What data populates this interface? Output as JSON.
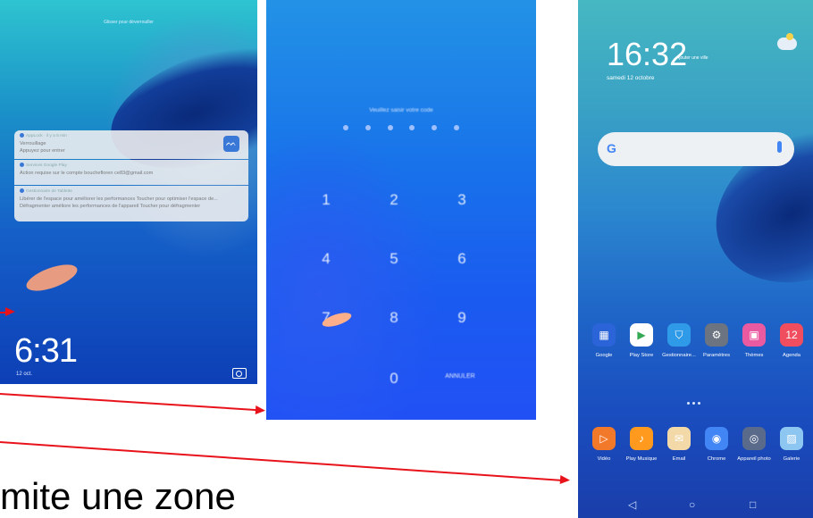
{
  "lock_screen": {
    "unlock_hint": "Glisser pour déverrouiller",
    "notifications": [
      {
        "app": "AppLock",
        "meta": "· il y a 5 min",
        "title": "Verrouillage",
        "text": "Appuyez pour entrer"
      },
      {
        "app": "Services Google Play",
        "meta": "",
        "title": "",
        "text": "Action requise sur le compte bouchefloren ce83@gmail.com"
      },
      {
        "app": "Gestionnaire de Tablette",
        "meta": "",
        "title": "",
        "text": "Libérer de l'espace pour améliorer les performances Toucher pour optimiser l'espace de... Défragmenter améliore les performances de l'appareil Toucher pour défragmenter"
      }
    ],
    "time": "6:31",
    "date": "12 oct."
  },
  "pin_screen": {
    "title": "Veuillez saisir votre code",
    "keys": [
      "1",
      "2",
      "3",
      "4",
      "5",
      "6",
      "7",
      "8",
      "9",
      "0"
    ],
    "cancel": "ANNULER"
  },
  "home_screen": {
    "time": "16:32",
    "add_city": "Ajouter une ville",
    "date": "samedi 12 octobre",
    "search_logo": "G",
    "apps_row1": [
      {
        "label": "Google",
        "icon": "folder-icon",
        "color": "#2b63d9",
        "glyph": "▦"
      },
      {
        "label": "Play Store",
        "icon": "play-store-icon",
        "color": "#ffffff",
        "glyph": "▶"
      },
      {
        "label": "Gestionnaire...",
        "icon": "shield-icon",
        "color": "#2f9ae8",
        "glyph": "⛉"
      },
      {
        "label": "Paramètres",
        "icon": "gear-icon",
        "color": "#6b7480",
        "glyph": "⚙"
      },
      {
        "label": "Thèmes",
        "icon": "brush-icon",
        "color": "#ea5aa0",
        "glyph": "▣"
      },
      {
        "label": "Agenda",
        "icon": "calendar-icon",
        "color": "#f04d5e",
        "glyph": "12"
      }
    ],
    "apps_row2": [
      {
        "label": "Vidéo",
        "icon": "video-icon",
        "color": "#f2792a",
        "glyph": "▷"
      },
      {
        "label": "Play Musique",
        "icon": "music-icon",
        "color": "#ff9a1f",
        "glyph": "♪"
      },
      {
        "label": "Email",
        "icon": "email-icon",
        "color": "#f3d9a8",
        "glyph": "✉"
      },
      {
        "label": "Chrome",
        "icon": "chrome-icon",
        "color": "#4285f4",
        "glyph": "◉"
      },
      {
        "label": "Appareil photo",
        "icon": "camera-icon",
        "color": "#5a6a8a",
        "glyph": "◎"
      },
      {
        "label": "Galerie",
        "icon": "gallery-icon",
        "color": "#8ec6f2",
        "glyph": "▨"
      }
    ],
    "nav": {
      "back": "◁",
      "home": "○",
      "recent": "□"
    }
  },
  "caption": "mite une zone"
}
